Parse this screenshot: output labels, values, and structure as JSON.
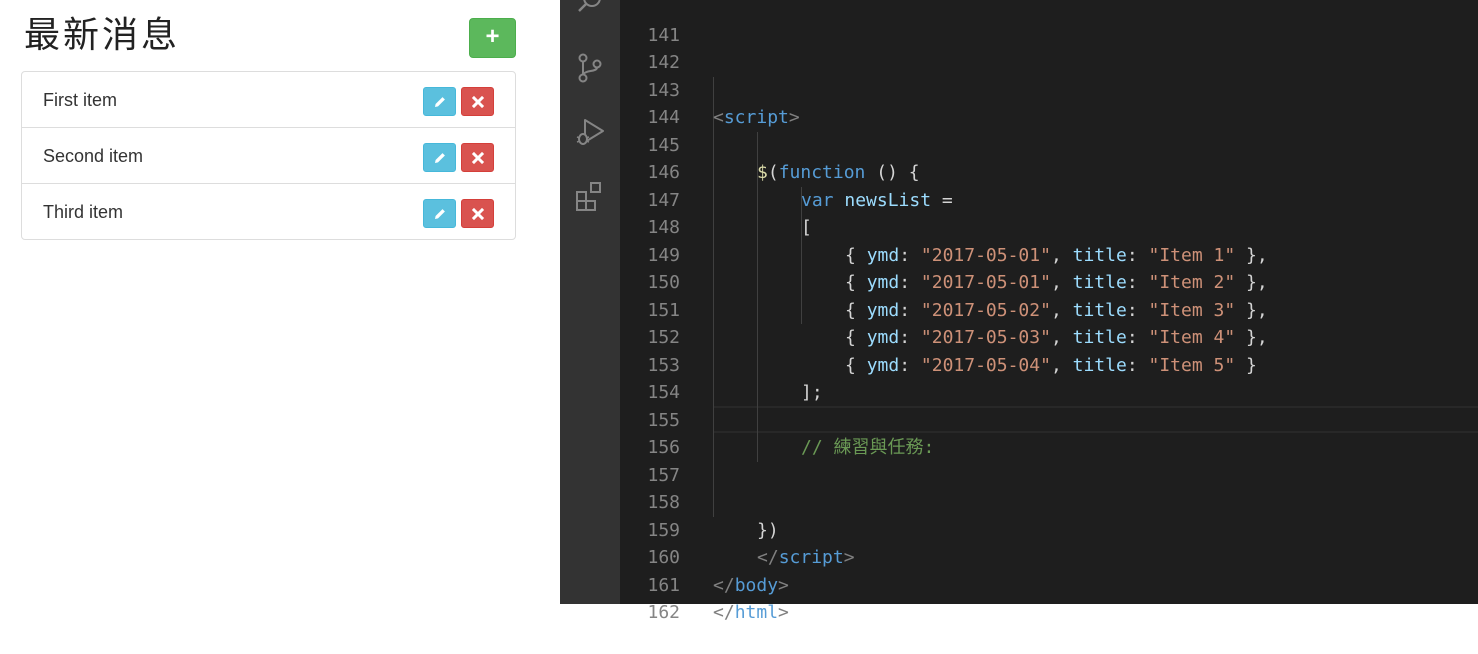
{
  "preview": {
    "title": "最新消息",
    "add_button_icon": "plus-icon",
    "items": [
      {
        "label": "First item"
      },
      {
        "label": "Second item"
      },
      {
        "label": "Third item"
      }
    ],
    "edit_icon": "pencil-icon",
    "delete_icon": "x-icon",
    "colors": {
      "success": "#5cb85c",
      "info": "#5bc0de",
      "danger": "#d9534f"
    }
  },
  "activity_bar": {
    "icons": [
      "search-icon",
      "source-control-icon",
      "run-debug-icon",
      "extensions-icon"
    ]
  },
  "editor": {
    "line_numbers": [
      "141",
      "142",
      "143",
      "144",
      "145",
      "146",
      "147",
      "148",
      "149",
      "150",
      "151",
      "152",
      "153",
      "154",
      "155",
      "156",
      "157",
      "158",
      "159",
      "160",
      "161",
      "162"
    ],
    "code": {
      "l143_open": "<",
      "l143_tag": "script",
      "l143_close": ">",
      "l145_dollar": "$",
      "l145_paren": "(",
      "l145_kw": "function",
      "l145_rest": " () {",
      "l146_kw": "var",
      "l146_var": "newsList",
      "l146_rest": " =",
      "l147": "[",
      "rows": [
        {
          "ymd": "\"2017-05-01\"",
          "title": "\"Item 1\"",
          "end": " },"
        },
        {
          "ymd": "\"2017-05-01\"",
          "title": "\"Item 2\"",
          "end": " },"
        },
        {
          "ymd": "\"2017-05-02\"",
          "title": "\"Item 3\"",
          "end": " },"
        },
        {
          "ymd": "\"2017-05-03\"",
          "title": "\"Item 4\"",
          "end": " },"
        },
        {
          "ymd": "\"2017-05-04\"",
          "title": "\"Item 5\"",
          "end": " }"
        }
      ],
      "row_open": "{ ",
      "key_ymd": "ymd",
      "key_title": "title",
      "colon": ": ",
      "comma": ", ",
      "l153": "];",
      "l155": "// 練習與任務:",
      "l158": "})",
      "l159_open": "</",
      "l159_tag": "script",
      "l159_close": ">",
      "l160_open": "</",
      "l160_tag": "body",
      "l160_close": ">",
      "l161_open": "</",
      "l161_tag": "html",
      "l161_close": ">"
    },
    "colors": {
      "background": "#1e1e1e",
      "keyword": "#569cd6",
      "string": "#ce9178",
      "variable": "#9cdcfe",
      "comment": "#6a9955"
    }
  }
}
